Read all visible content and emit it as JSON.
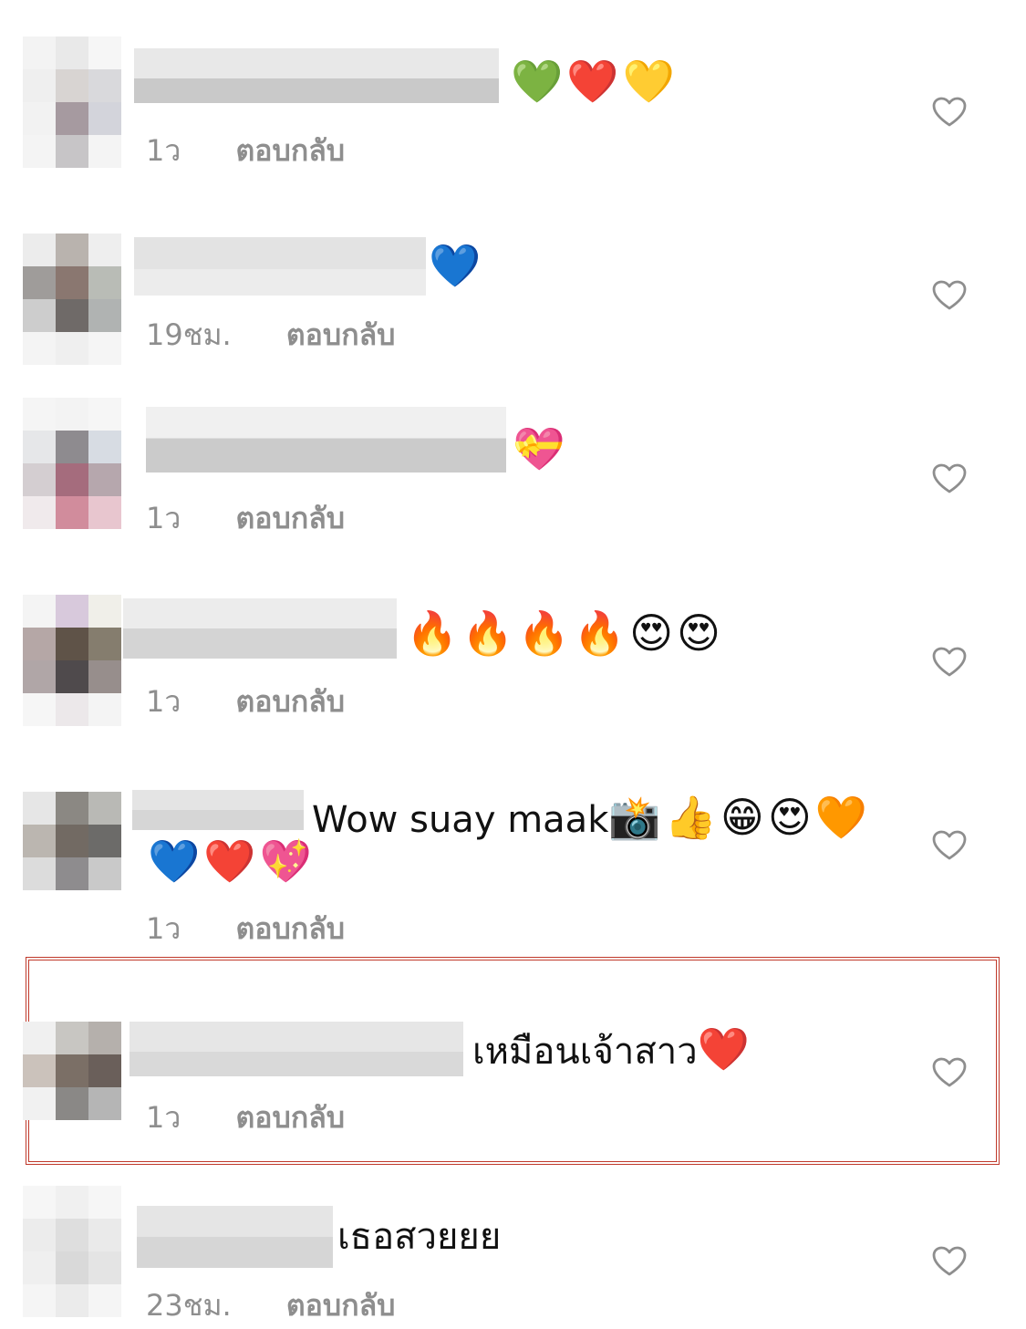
{
  "comments": [
    {
      "text": "💚❤️💛",
      "time": "1ว",
      "reply": "ตอบกลับ"
    },
    {
      "text": "💙",
      "time": "19ชม.",
      "reply": "ตอบกลับ"
    },
    {
      "text": "💝",
      "time": "1ว",
      "reply": "ตอบกลับ"
    },
    {
      "text": "🔥🔥🔥🔥😍😍",
      "time": "1ว",
      "reply": "ตอบกลับ"
    },
    {
      "text": "Wow suay maak",
      "text_emoji": "📸👍😁😍🧡",
      "line2": "💙❤️💖",
      "time": "1ว",
      "reply": "ตอบกลับ"
    },
    {
      "text": "เหมือนเจ้าสาว",
      "text_emoji": "❤️",
      "time": "1ว",
      "reply": "ตอบกลับ"
    },
    {
      "text": "เธอสวยยย",
      "time": "23ชม.",
      "reply": "ตอบกลับ"
    }
  ],
  "icons": {
    "like": "heart-outline-icon"
  },
  "colors": {
    "meta": "#8e8e8e",
    "highlight_border": "#c0392b"
  }
}
